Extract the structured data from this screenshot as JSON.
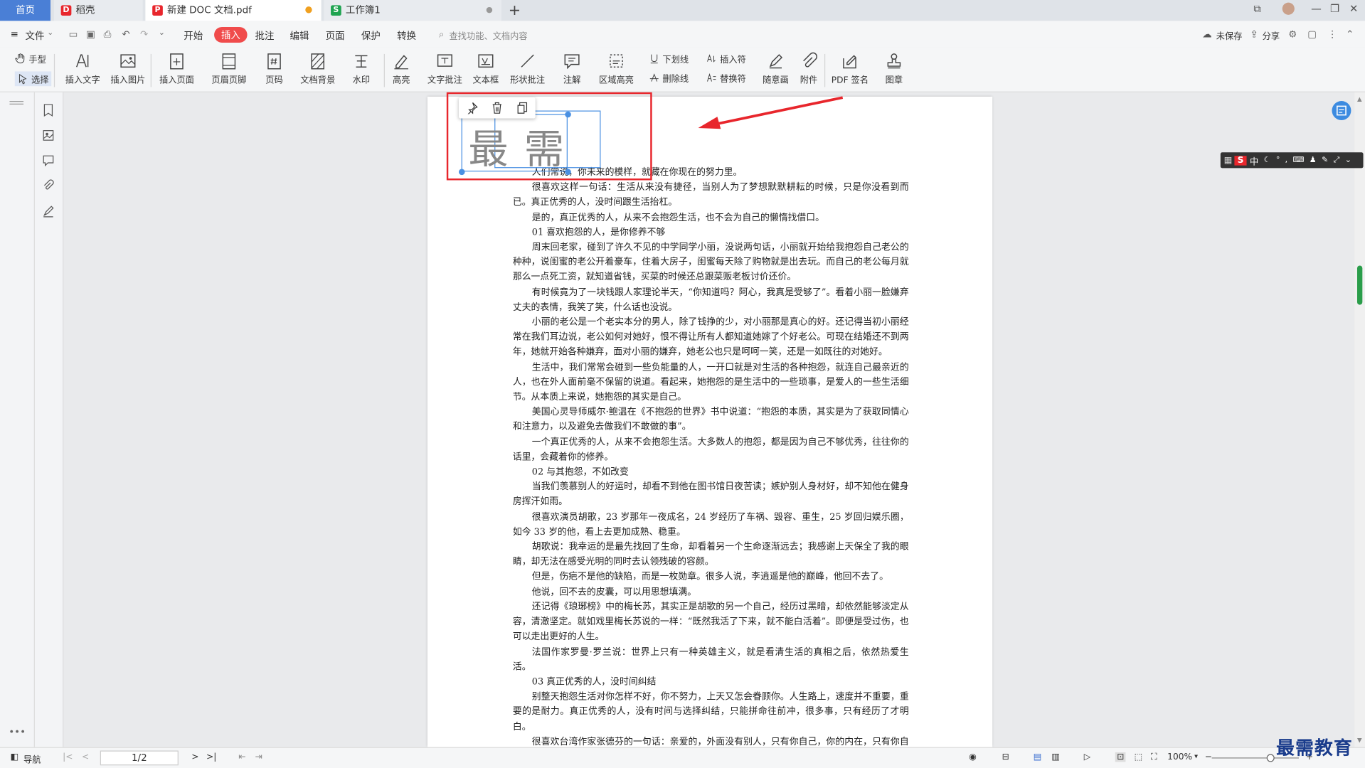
{
  "tabs": {
    "home": "首页",
    "shell": "稻壳",
    "doc": "新建 DOC 文档.pdf",
    "sheet": "工作簿1",
    "new_tab": "+"
  },
  "menu": {
    "file": "文件",
    "start": "开始",
    "insert": "插入",
    "annotate": "批注",
    "edit": "编辑",
    "page": "页面",
    "protect": "保护",
    "convert": "转换",
    "search_placeholder": "查找功能、文档内容",
    "unsaved": "未保存",
    "share": "分享"
  },
  "ribbon": {
    "hand": "手型",
    "select": "选择",
    "insert_text": "插入文字",
    "insert_image": "插入图片",
    "insert_page": "插入页面",
    "header_footer": "页眉页脚",
    "page_number": "页码",
    "doc_background": "文档背景",
    "watermark": "水印",
    "highlight": "高亮",
    "text_annotation": "文字批注",
    "textbox": "文本框",
    "shape_annotation": "形状批注",
    "note": "注解",
    "area_highlight": "区域高亮",
    "underline": "下划线",
    "strikethrough": "删除线",
    "insert_symbol": "插入符",
    "replace_symbol": "替换符",
    "freehand": "随意画",
    "attachment": "附件",
    "pdf_sign": "PDF 签名",
    "stamp": "图章"
  },
  "signature": {
    "text": "最需"
  },
  "document": {
    "paragraphs": [
      "人们常说，你未来的模样，就藏在你现在的努力里。",
      "很喜欢这样一句话：生活从来没有捷径，当别人为了梦想默默耕耘的时候，只是你没看到而已。真正优秀的人，没时间跟生活抬杠。",
      "是的，真正优秀的人，从来不会抱怨生活，也不会为自己的懒惰找借口。",
      "01 喜欢抱怨的人，是你修养不够",
      "周末回老家，碰到了许久不见的中学同学小丽，没说两句话，小丽就开始给我抱怨自己老公的种种，说闺蜜的老公开着豪车，住着大房子，闺蜜每天除了购物就是出去玩。而自己的老公每月就那么一点死工资，就知道省钱，买菜的时候还总跟菜贩老板讨价还价。",
      "有时候竟为了一块钱跟人家理论半天，“你知道吗？阿心，我真是受够了”。看着小丽一脸嫌弃丈夫的表情，我笑了笑，什么话也没说。",
      "小丽的老公是一个老实本分的男人，除了钱挣的少，对小丽那是真心的好。还记得当初小丽经常在我们耳边说，老公如何对她好，恨不得让所有人都知道她嫁了个好老公。可现在结婚还不到两年，她就开始各种嫌弃，面对小丽的嫌弃，她老公也只是呵呵一笑，还是一如既往的对她好。",
      "生活中，我们常常会碰到一些负能量的人，一开口就是对生活的各种抱怨，就连自己最亲近的人，也在外人面前毫不保留的说道。看起来，她抱怨的是生活中的一些琐事，是爱人的一些生活细节。从本质上来说，她抱怨的其实是自己。",
      "美国心灵导师威尔·鲍温在《不抱怨的世界》书中说道：“抱怨的本质，其实是为了获取同情心和注意力，以及避免去做我们不敢做的事”。",
      "一个真正优秀的人，从来不会抱怨生活。大多数人的抱怨，都是因为自己不够优秀，往往你的话里，会藏着你的修养。",
      "02 与其抱怨，不如改变",
      "当我们羡慕别人的好运时，却看不到他在图书馆日夜苦读；嫉妒别人身材好，却不知他在健身房挥汗如雨。",
      "很喜欢演员胡歌，23 岁那年一夜成名，24 岁经历了车祸、毁容、重生，25 岁回归娱乐圈，如今 33 岁的他，看上去更加成熟、稳重。",
      "胡歌说：我幸运的是最先找回了生命，却看着另一个生命逐渐远去；我感谢上天保全了我的眼睛，却无法在感受光明的同时去认领残破的容颜。",
      "但是，伤疤不是他的缺陷，而是一枚勋章。很多人说，李逍遥是他的巅峰，他回不去了。",
      "他说，回不去的皮囊，可以用思想填满。",
      "还记得《琅琊榜》中的梅长苏，其实正是胡歌的另一个自己，经历过黑暗，却依然能够淡定从容，清澈坚定。就如戏里梅长苏说的一样：“既然我活了下来，就不能白活着”。即便是受过伤，也可以走出更好的人生。",
      "法国作家罗曼·罗兰说：世界上只有一种英雄主义，就是看清生活的真相之后，依然热爱生活。",
      "03 真正优秀的人，没时间纠结",
      "别整天抱怨生活对你怎样不好，你不努力，上天又怎会眷顾你。人生路上，速度并不重要，重要的是耐力。真正优秀的人，没有时间与选择纠结，只能拼命往前冲，很多事，只有经历了才明白。",
      "很喜欢台湾作家张德芬的一句话：亲爱的，外面没有别人，只有你自己，你的内在，只有你自己。"
    ]
  },
  "ime": {
    "label": "中"
  },
  "status": {
    "nav": "导航",
    "page": "1/2",
    "zoom": "100%"
  },
  "watermark": {
    "text": "最需教育"
  }
}
